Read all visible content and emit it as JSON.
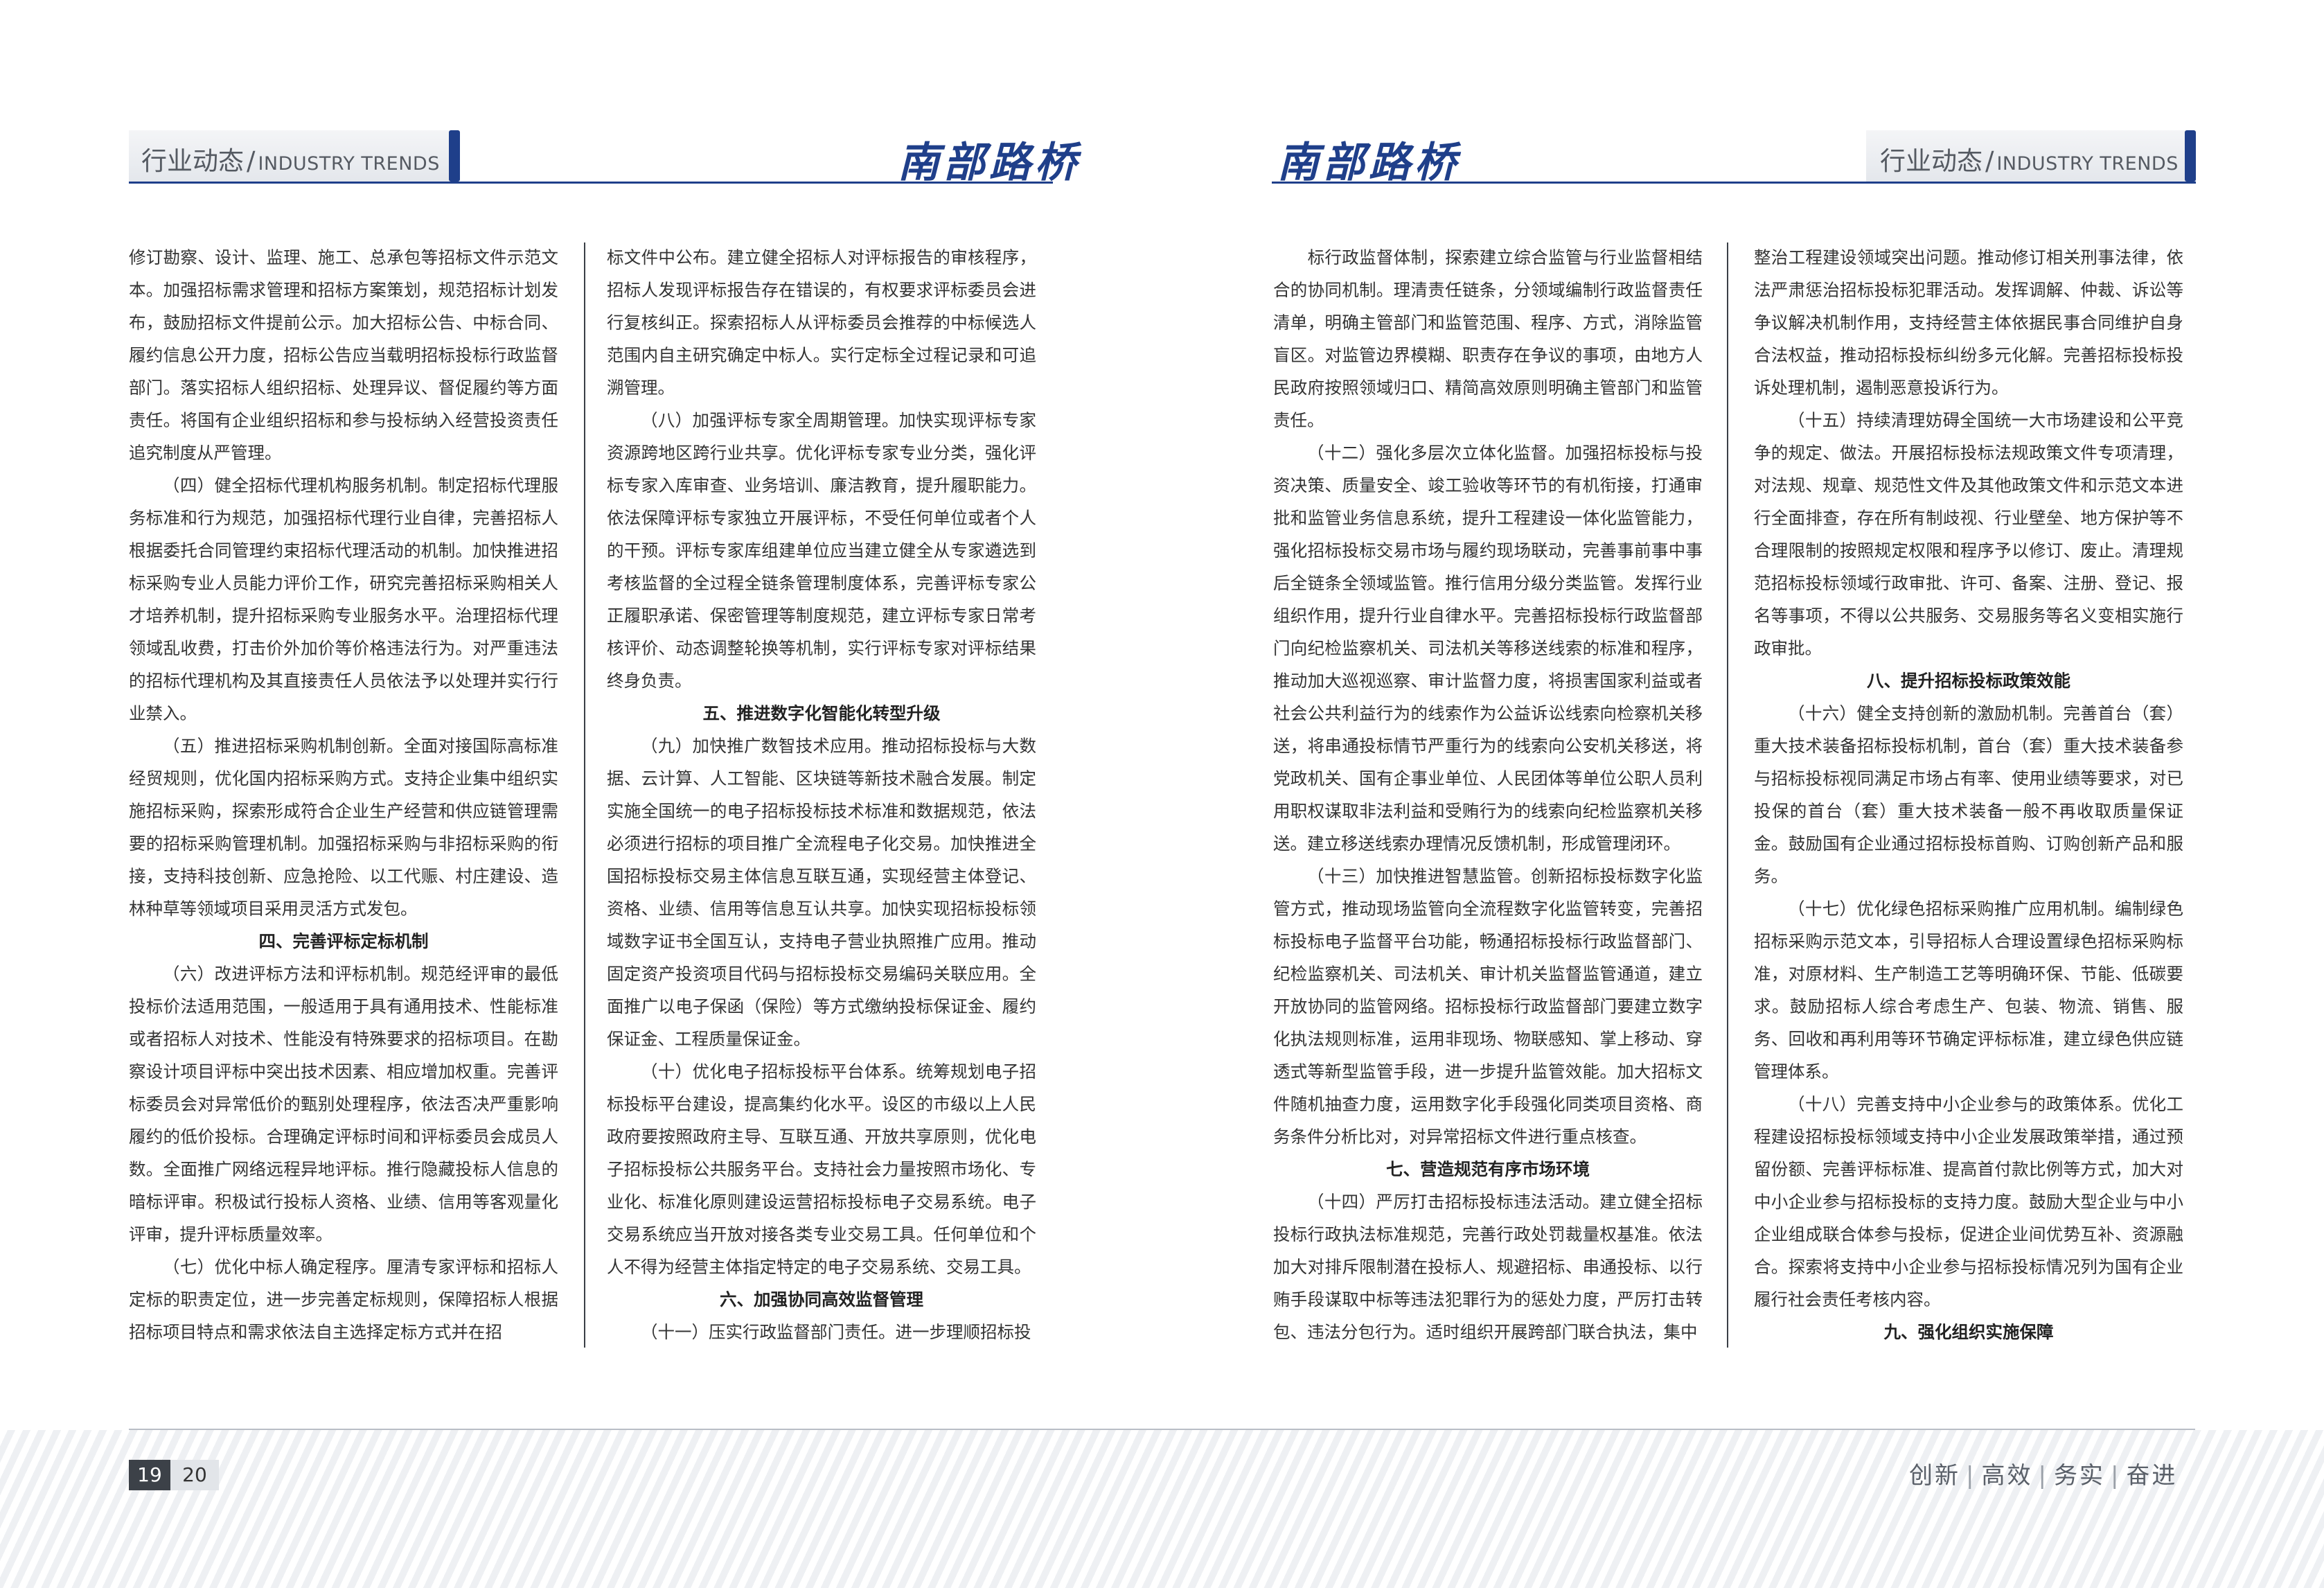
{
  "header": {
    "section_cn": "行业动态",
    "sep": "/",
    "section_en": "INDUSTRY TRENDS",
    "brand": "南部路桥"
  },
  "footer": {
    "page_left": "19",
    "page_right": "20",
    "slogan": [
      "创新",
      "高效",
      "务实",
      "奋进"
    ]
  },
  "columns": [
    [
      {
        "t": "p",
        "cls": "cont",
        "text": "修订勘察、设计、监理、施工、总承包等招标文件示范文本。加强招标需求管理和招标方案策划，规范招标计划发布，鼓励招标文件提前公示。加大招标公告、中标合同、履约信息公开力度，招标公告应当载明招标投标行政监督部门。落实招标人组织招标、处理异议、督促履约等方面责任。将国有企业组织招标和参与投标纳入经营投资责任追究制度从严管理。"
      },
      {
        "t": "p",
        "text": "（四）健全招标代理机构服务机制。制定招标代理服务标准和行为规范，加强招标代理行业自律，完善招标人根据委托合同管理约束招标代理活动的机制。加快推进招标采购专业人员能力评价工作，研究完善招标采购相关人才培养机制，提升招标采购专业服务水平。治理招标代理领域乱收费，打击价外加价等价格违法行为。对严重违法的招标代理机构及其直接责任人员依法予以处理并实行行业禁入。"
      },
      {
        "t": "p",
        "text": "（五）推进招标采购机制创新。全面对接国际高标准经贸规则，优化国内招标采购方式。支持企业集中组织实施招标采购，探索形成符合企业生产经营和供应链管理需要的招标采购管理机制。加强招标采购与非招标采购的衔接，支持科技创新、应急抢险、以工代赈、村庄建设、造林种草等领域项目采用灵活方式发包。"
      },
      {
        "t": "h",
        "text": "四、完善评标定标机制"
      },
      {
        "t": "p",
        "text": "（六）改进评标方法和评标机制。规范经评审的最低投标价法适用范围，一般适用于具有通用技术、性能标准或者招标人对技术、性能没有特殊要求的招标项目。在勘察设计项目评标中突出技术因素、相应增加权重。完善评标委员会对异常低价的甄别处理程序，依法否决严重影响履约的低价投标。合理确定评标时间和评标委员会成员人数。全面推广网络远程异地评标。推行隐藏投标人信息的暗标评审。积极试行投标人资格、业绩、信用等客观量化评审，提升评标质量效率。"
      },
      {
        "t": "p",
        "text": "（七）优化中标人确定程序。厘清专家评标和招标人定标的职责定位，进一步完善定标规则，保障招标人根据招标项目特点和需求依法自主选择定标方式并在招"
      }
    ],
    [
      {
        "t": "p",
        "cls": "cont",
        "text": "标文件中公布。建立健全招标人对评标报告的审核程序，招标人发现评标报告存在错误的，有权要求评标委员会进行复核纠正。探索招标人从评标委员会推荐的中标候选人范围内自主研究确定中标人。实行定标全过程记录和可追溯管理。"
      },
      {
        "t": "p",
        "text": "（八）加强评标专家全周期管理。加快实现评标专家资源跨地区跨行业共享。优化评标专家专业分类，强化评标专家入库审查、业务培训、廉洁教育，提升履职能力。依法保障评标专家独立开展评标，不受任何单位或者个人的干预。评标专家库组建单位应当建立健全从专家遴选到考核监督的全过程全链条管理制度体系，完善评标专家公正履职承诺、保密管理等制度规范，建立评标专家日常考核评价、动态调整轮换等机制，实行评标专家对评标结果终身负责。"
      },
      {
        "t": "h",
        "text": "五、推进数字化智能化转型升级"
      },
      {
        "t": "p",
        "text": "（九）加快推广数智技术应用。推动招标投标与大数据、云计算、人工智能、区块链等新技术融合发展。制定实施全国统一的电子招标投标技术标准和数据规范，依法必须进行招标的项目推广全流程电子化交易。加快推进全国招标投标交易主体信息互联互通，实现经营主体登记、资格、业绩、信用等信息互认共享。加快实现招标投标领域数字证书全国互认，支持电子营业执照推广应用。推动固定资产投资项目代码与招标投标交易编码关联应用。全面推广以电子保函（保险）等方式缴纳投标保证金、履约保证金、工程质量保证金。"
      },
      {
        "t": "p",
        "text": "（十）优化电子招标投标平台体系。统筹规划电子招标投标平台建设，提高集约化水平。设区的市级以上人民政府要按照政府主导、互联互通、开放共享原则，优化电子招标投标公共服务平台。支持社会力量按照市场化、专业化、标准化原则建设运营招标投标电子交易系统。电子交易系统应当开放对接各类专业交易工具。任何单位和个人不得为经营主体指定特定的电子交易系统、交易工具。"
      },
      {
        "t": "h",
        "text": "六、加强协同高效监督管理"
      },
      {
        "t": "p",
        "text": "（十一）压实行政监督部门责任。进一步理顺招标投"
      }
    ],
    [
      {
        "t": "p",
        "cls": "cont",
        "text": "　　标行政监督体制，探索建立综合监管与行业监督相结合的协同机制。理清责任链条，分领域编制行政监督责任清单，明确主管部门和监管范围、程序、方式，消除监管盲区。对监管边界模糊、职责存在争议的事项，由地方人民政府按照领域归口、精简高效原则明确主管部门和监管责任。"
      },
      {
        "t": "p",
        "text": "（十二）强化多层次立体化监督。加强招标投标与投资决策、质量安全、竣工验收等环节的有机衔接，打通审批和监管业务信息系统，提升工程建设一体化监管能力，强化招标投标交易市场与履约现场联动，完善事前事中事后全链条全领域监管。推行信用分级分类监管。发挥行业组织作用，提升行业自律水平。完善招标投标行政监督部门向纪检监察机关、司法机关等移送线索的标准和程序，推动加大巡视巡察、审计监督力度，将损害国家利益或者社会公共利益行为的线索作为公益诉讼线索向检察机关移送，将串通投标情节严重行为的线索向公安机关移送，将党政机关、国有企事业单位、人民团体等单位公职人员利用职权谋取非法利益和受贿行为的线索向纪检监察机关移送。建立移送线索办理情况反馈机制，形成管理闭环。"
      },
      {
        "t": "p",
        "text": "（十三）加快推进智慧监管。创新招标投标数字化监管方式，推动现场监管向全流程数字化监管转变，完善招标投标电子监督平台功能，畅通招标投标行政监督部门、纪检监察机关、司法机关、审计机关监督监管通道，建立开放协同的监管网络。招标投标行政监督部门要建立数字化执法规则标准，运用非现场、物联感知、掌上移动、穿透式等新型监管手段，进一步提升监管效能。加大招标文件随机抽查力度，运用数字化手段强化同类项目资格、商务条件分析比对，对异常招标文件进行重点核查。"
      },
      {
        "t": "h",
        "text": "七、营造规范有序市场环境"
      },
      {
        "t": "p",
        "text": "（十四）严厉打击招标投标违法活动。建立健全招标投标行政执法标准规范，完善行政处罚裁量权基准。依法加大对排斥限制潜在投标人、规避招标、串通投标、以行贿手段谋取中标等违法犯罪行为的惩处力度，严厉打击转包、违法分包行为。适时组织开展跨部门联合执法，集中"
      }
    ],
    [
      {
        "t": "p",
        "cls": "cont",
        "text": "整治工程建设领域突出问题。推动修订相关刑事法律，依法严肃惩治招标投标犯罪活动。发挥调解、仲裁、诉讼等争议解决机制作用，支持经营主体依据民事合同维护自身合法权益，推动招标投标纠纷多元化解。完善招标投标投诉处理机制，遏制恶意投诉行为。"
      },
      {
        "t": "p",
        "text": "（十五）持续清理妨碍全国统一大市场建设和公平竞争的规定、做法。开展招标投标法规政策文件专项清理，对法规、规章、规范性文件及其他政策文件和示范文本进行全面排查，存在所有制歧视、行业壁垒、地方保护等不合理限制的按照规定权限和程序予以修订、废止。清理规范招标投标领域行政审批、许可、备案、注册、登记、报名等事项，不得以公共服务、交易服务等名义变相实施行政审批。"
      },
      {
        "t": "h",
        "text": "八、提升招标投标政策效能"
      },
      {
        "t": "p",
        "text": "（十六）健全支持创新的激励机制。完善首台（套）重大技术装备招标投标机制，首台（套）重大技术装备参与招标投标视同满足市场占有率、使用业绩等要求，对已投保的首台（套）重大技术装备一般不再收取质量保证金。鼓励国有企业通过招标投标首购、订购创新产品和服务。"
      },
      {
        "t": "p",
        "text": "（十七）优化绿色招标采购推广应用机制。编制绿色招标采购示范文本，引导招标人合理设置绿色招标采购标准，对原材料、生产制造工艺等明确环保、节能、低碳要求。鼓励招标人综合考虑生产、包装、物流、销售、服务、回收和再利用等环节确定评标标准，建立绿色供应链管理体系。"
      },
      {
        "t": "p",
        "text": "（十八）完善支持中小企业参与的政策体系。优化工程建设招标投标领域支持中小企业发展政策举措，通过预留份额、完善评标标准、提高首付款比例等方式，加大对中小企业参与招标投标的支持力度。鼓励大型企业与中小企业组成联合体参与投标，促进企业间优势互补、资源融合。探索将支持中小企业参与招标投标情况列为国有企业履行社会责任考核内容。"
      },
      {
        "t": "h",
        "text": "九、强化组织实施保障"
      }
    ]
  ]
}
